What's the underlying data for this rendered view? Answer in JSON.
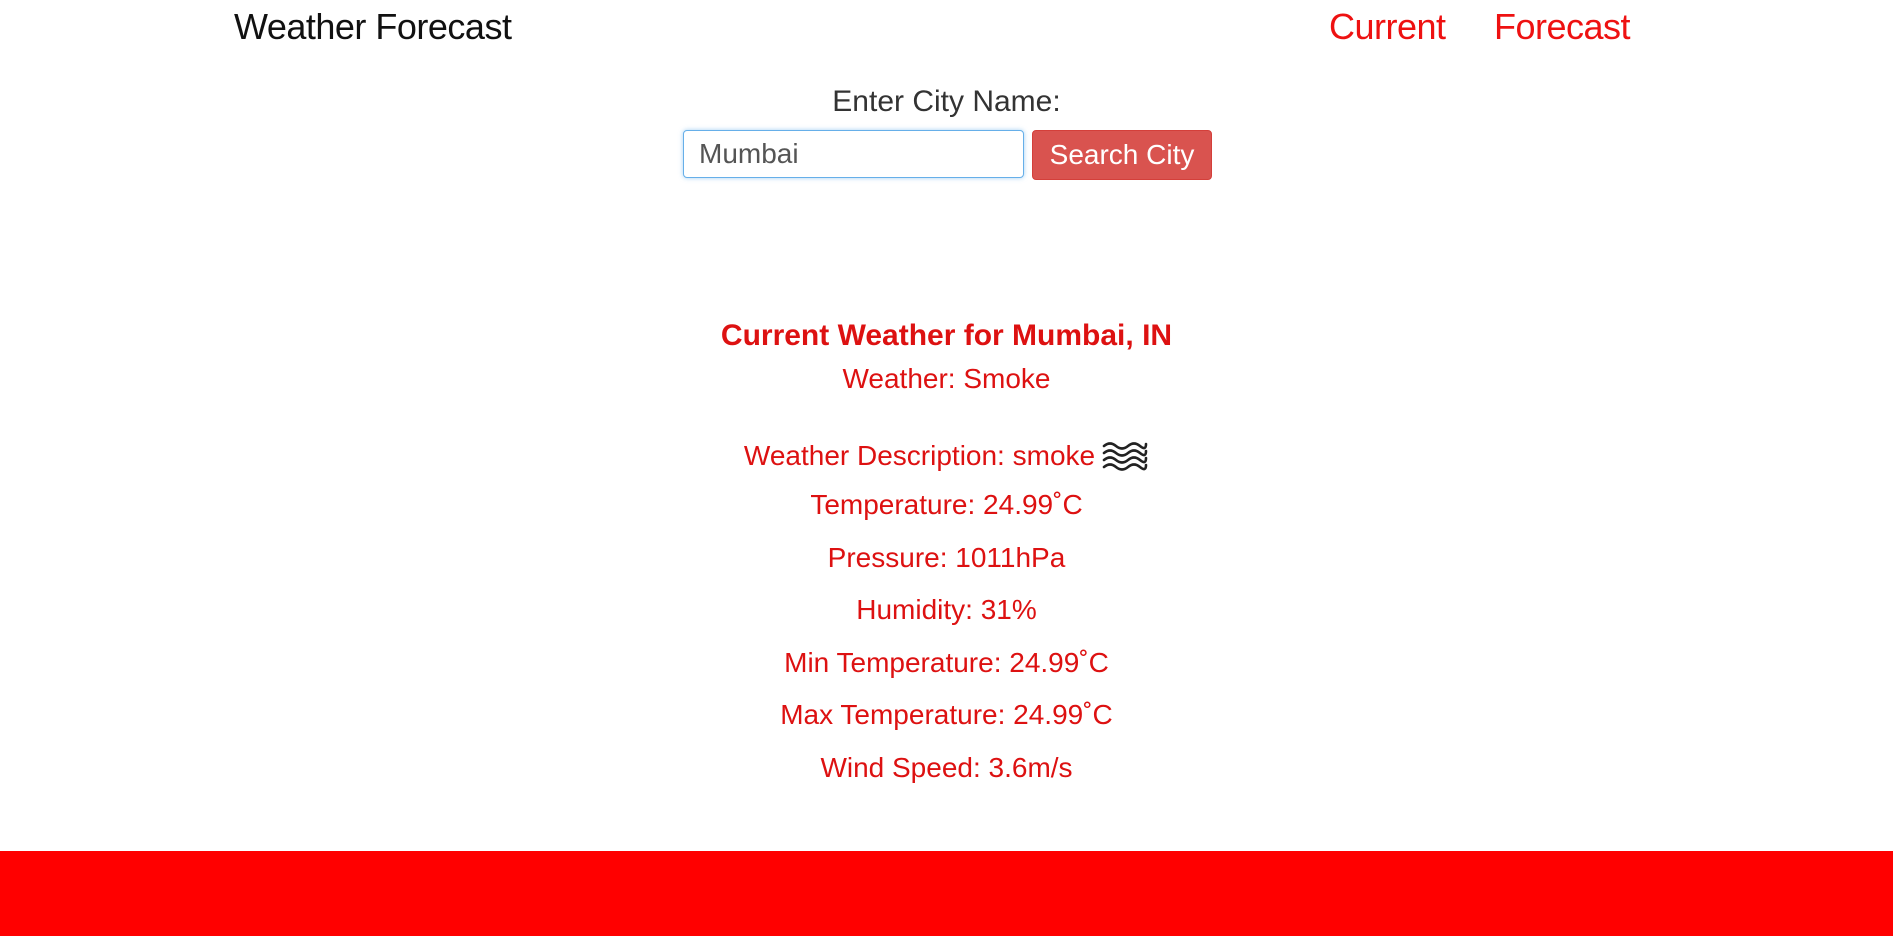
{
  "navbar": {
    "brand": "Weather Forecast",
    "links": [
      "Current",
      "Forecast"
    ]
  },
  "search": {
    "label": "Enter City Name:",
    "value": "Mumbai",
    "button_label": "Search City"
  },
  "weather": {
    "title": "Current Weather for Mumbai, IN",
    "main": "Weather: Smoke",
    "description": "Weather Description: smoke",
    "icon": "smoke-icon",
    "temperature": "Temperature: 24.99˚C",
    "pressure": "Pressure: 1011hPa",
    "humidity": "Humidity: 31%",
    "min_temperature": "Min Temperature: 24.99˚C",
    "max_temperature": "Max Temperature: 24.99˚C",
    "wind_speed": "Wind Speed: 3.6m/s"
  },
  "colors": {
    "accent": "#ee1111",
    "button": "#d9534f",
    "footer": "#ff0000"
  }
}
